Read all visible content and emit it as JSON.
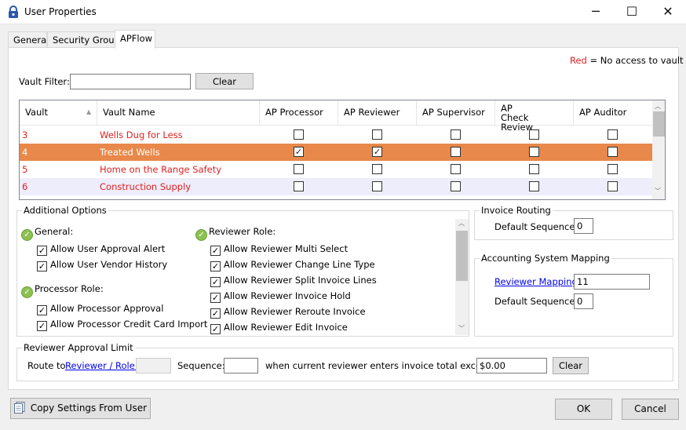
{
  "window": {
    "title": "User Properties",
    "minimize": "─",
    "maximize": "☐",
    "close": "✕"
  },
  "tabs": [
    {
      "label": "General"
    },
    {
      "label": "Security Groups"
    },
    {
      "label": "APFlow"
    }
  ],
  "legend": {
    "red_word": "Red",
    "text": "= No access to vault"
  },
  "vault_filter": {
    "label": "Vault Filter:",
    "value": "",
    "clear_label": "Clear"
  },
  "grid": {
    "headers": [
      "Vault",
      "Vault Name",
      "AP Processor",
      "AP Reviewer",
      "AP Supervisor",
      "AP Check Review",
      "AP Auditor"
    ],
    "sort_arrow": "▲",
    "rows": [
      {
        "vault": "3",
        "name": "Wells Dug for Less",
        "checks": [
          false,
          false,
          false,
          false,
          false
        ]
      },
      {
        "vault": "4",
        "name": "Treated Wells",
        "checks": [
          true,
          true,
          false,
          false,
          false
        ]
      },
      {
        "vault": "5",
        "name": "Home on the Range Safety",
        "checks": [
          false,
          false,
          false,
          false,
          false
        ]
      },
      {
        "vault": "6",
        "name": "Construction Supply",
        "checks": [
          false,
          false,
          false,
          false,
          false
        ]
      }
    ]
  },
  "additional_options": {
    "title": "Additional Options",
    "general": {
      "label": "General:",
      "items": [
        {
          "label": "Allow User Approval Alert",
          "checked": true
        },
        {
          "label": "Allow User Vendor History",
          "checked": true
        }
      ]
    },
    "processor": {
      "label": "Processor Role:",
      "items": [
        {
          "label": "Allow Processor Approval",
          "checked": true
        },
        {
          "label": "Allow Processor Credit Card Import",
          "checked": true
        }
      ]
    },
    "reviewer": {
      "label": "Reviewer Role:",
      "items": [
        {
          "label": "Allow Reviewer Multi Select",
          "checked": true
        },
        {
          "label": "Allow Reviewer Change Line Type",
          "checked": true
        },
        {
          "label": "Allow Reviewer Split Invoice Lines",
          "checked": true
        },
        {
          "label": "Allow Reviewer Invoice Hold",
          "checked": true
        },
        {
          "label": "Allow Reviewer Reroute Invoice",
          "checked": true
        },
        {
          "label": "Allow Reviewer Edit Invoice",
          "checked": true
        }
      ]
    }
  },
  "invoice_routing": {
    "title": "Invoice Routing",
    "default_sequence_label": "Default Sequence:",
    "default_sequence_value": "0"
  },
  "accounting_mapping": {
    "title": "Accounting System Mapping",
    "reviewer_mapping_label": "Reviewer Mapping:",
    "reviewer_mapping_value": "11",
    "default_sequence_label": "Default Sequence:",
    "default_sequence_value": "0"
  },
  "approval_limit": {
    "title": "Reviewer Approval Limit",
    "route_to": "Route to",
    "reviewer_role_link": "Reviewer / Role:",
    "reviewer_role_value": "",
    "sequence_label": "Sequence:",
    "sequence_value": "",
    "condition_text": "when current reviewer enters invoice total exceeding:",
    "amount_value": "$0.00",
    "clear_label": "Clear"
  },
  "footer": {
    "copy_settings_label": "Copy Settings From User",
    "ok_label": "OK",
    "cancel_label": "Cancel"
  },
  "colors": {
    "selected_row": "#e8884a",
    "alt_row": "#ededfb",
    "no_access": "#e02020",
    "link": "#0000ee"
  }
}
